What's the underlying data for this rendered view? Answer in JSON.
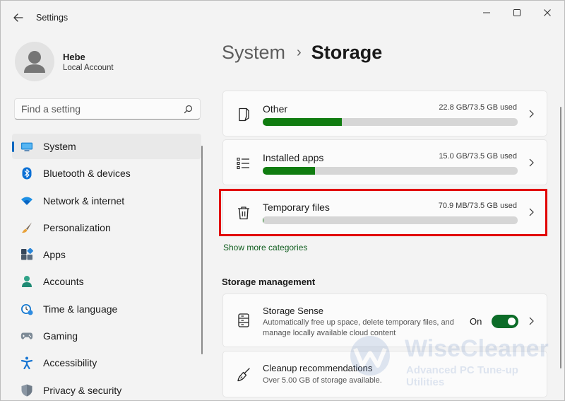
{
  "window": {
    "title": "Settings",
    "controls": {
      "minimize": "minimize-icon",
      "maximize": "maximize-icon",
      "close": "close-icon"
    }
  },
  "profile": {
    "name": "Hebe",
    "account_type": "Local Account"
  },
  "search": {
    "placeholder": "Find a setting",
    "value": ""
  },
  "nav": {
    "items": [
      {
        "label": "System",
        "icon": "monitor-icon",
        "active": true
      },
      {
        "label": "Bluetooth & devices",
        "icon": "bluetooth-icon"
      },
      {
        "label": "Network & internet",
        "icon": "wifi-icon"
      },
      {
        "label": "Personalization",
        "icon": "brush-icon"
      },
      {
        "label": "Apps",
        "icon": "apps-icon"
      },
      {
        "label": "Accounts",
        "icon": "person-icon"
      },
      {
        "label": "Time & language",
        "icon": "clock-globe-icon"
      },
      {
        "label": "Gaming",
        "icon": "gamepad-icon"
      },
      {
        "label": "Accessibility",
        "icon": "accessibility-icon"
      },
      {
        "label": "Privacy & security",
        "icon": "shield-icon"
      }
    ]
  },
  "breadcrumb": {
    "parent": "System",
    "separator": "›",
    "current": "Storage"
  },
  "storage": {
    "categories": [
      {
        "label": "Other",
        "usage": "22.8 GB/73.5 GB used",
        "fraction": 0.31,
        "icon": "document-icon"
      },
      {
        "label": "Installed apps",
        "usage": "15.0 GB/73.5 GB used",
        "fraction": 0.204,
        "icon": "list-icon"
      },
      {
        "label": "Temporary files",
        "usage": "70.9 MB/73.5 GB used",
        "fraction": 0.001,
        "icon": "trash-icon"
      }
    ],
    "show_more": "Show more categories"
  },
  "management": {
    "title": "Storage management",
    "storage_sense": {
      "title": "Storage Sense",
      "description": "Automatically free up space, delete temporary files, and manage locally available cloud content",
      "toggle_label": "On",
      "toggle_on": true
    },
    "cleanup": {
      "title": "Cleanup recommendations",
      "description": "Over 5.00 GB of storage available."
    }
  },
  "watermark": {
    "brand": "WiseCleaner",
    "tagline": "Advanced PC Tune-up Utilities"
  },
  "colors": {
    "accent": "#0067c0",
    "progress": "#107c10",
    "toggle": "#0c6c28",
    "highlight": "#e10000"
  }
}
